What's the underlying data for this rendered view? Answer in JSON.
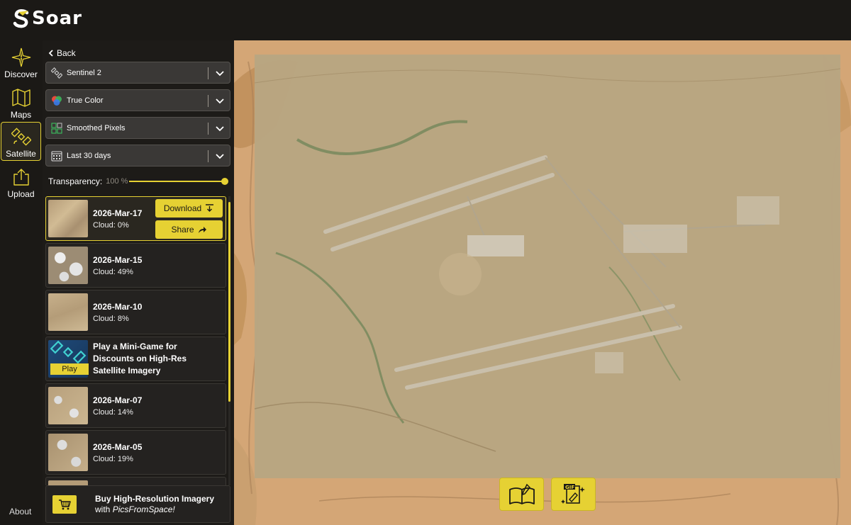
{
  "app": {
    "name": "Soar"
  },
  "rail": {
    "items": [
      {
        "label": "Discover",
        "icon": "compass-icon"
      },
      {
        "label": "Maps",
        "icon": "map-icon"
      },
      {
        "label": "Satellite",
        "icon": "satellite-icon",
        "active": true
      },
      {
        "label": "Upload",
        "icon": "upload-icon"
      }
    ],
    "about": "About"
  },
  "panel": {
    "back_label": "Back",
    "dropdowns": [
      {
        "label": "Sentinel 2",
        "icon": "satellite-icon"
      },
      {
        "label": "True Color",
        "icon": "color-circles-icon"
      },
      {
        "label": "Smoothed Pixels",
        "icon": "pixels-icon"
      },
      {
        "label": "Last 30 days",
        "icon": "calendar-icon"
      }
    ],
    "transparency_label": "Transparency:",
    "transparency_value": "100 %",
    "transparency_level": 1.0,
    "download_label": "Download",
    "share_label": "Share",
    "captures": [
      {
        "date": "2026-Mar-17",
        "cloud": "Cloud: 0%",
        "selected": true
      },
      {
        "date": "2026-Mar-15",
        "cloud": "Cloud: 49%"
      },
      {
        "date": "2026-Mar-10",
        "cloud": "Cloud: 8%"
      },
      {
        "date": "2026-Mar-07",
        "cloud": "Cloud: 14%"
      },
      {
        "date": "2026-Mar-05",
        "cloud": "Cloud: 19%"
      }
    ],
    "promo": {
      "text": "Play a Mini-Game for Discounts on High-Res Satellite Imagery",
      "play_label": "Play"
    },
    "buy": {
      "line1": "Buy High-Resolution Imagery",
      "line2_prefix": "with ",
      "line2_brand": "PicsFromSpace!"
    }
  },
  "map_buttons": [
    {
      "icon": "book-pen-icon"
    },
    {
      "icon": "gif-icon"
    }
  ],
  "colors": {
    "accent": "#e6d133",
    "panel": "#1d1b18",
    "card": "#242220"
  }
}
